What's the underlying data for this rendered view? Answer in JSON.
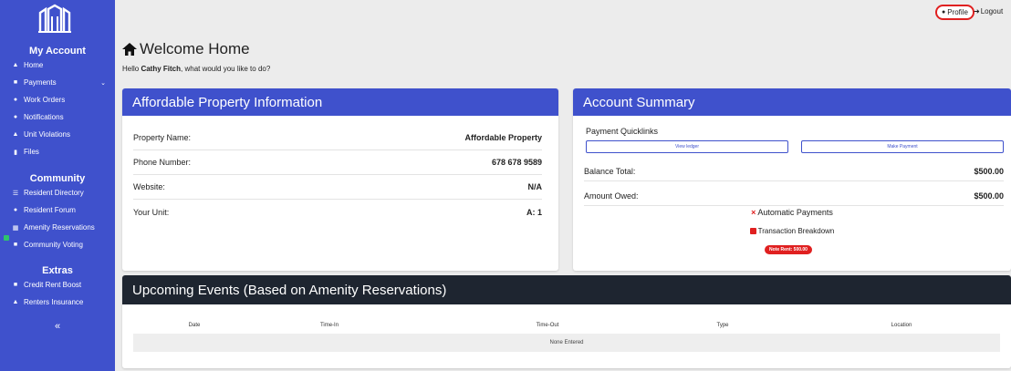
{
  "sidebar": {
    "my_account_title": "My Account",
    "my_account_items": [
      {
        "label": "Home",
        "icon": "home-icon"
      },
      {
        "label": "Payments",
        "icon": "bank-icon"
      },
      {
        "label": "Work Orders",
        "icon": "wrench-icon"
      },
      {
        "label": "Notifications",
        "icon": "chat-icon"
      },
      {
        "label": "Unit Violations",
        "icon": "warning-icon"
      },
      {
        "label": "Files",
        "icon": "file-icon"
      }
    ],
    "community_title": "Community",
    "community_items": [
      {
        "label": "Resident Directory",
        "icon": "directory-icon"
      },
      {
        "label": "Resident Forum",
        "icon": "forum-icon"
      },
      {
        "label": "Amenity Reservations",
        "icon": "calendar-icon"
      },
      {
        "label": "Community Voting",
        "icon": "vote-icon"
      }
    ],
    "extras_title": "Extras",
    "extras_items": [
      {
        "label": "Credit Rent Boost",
        "icon": "bank-icon"
      },
      {
        "label": "Renters Insurance",
        "icon": "home-shield-icon"
      }
    ],
    "collapse_label": "«"
  },
  "topbar": {
    "profile_label": "Profile",
    "logout_label": "Logout"
  },
  "welcome": {
    "title": "Welcome Home",
    "greeting_prefix": "Hello ",
    "user_name": "Cathy Fitch",
    "greeting_suffix": ", what would you like to do?"
  },
  "property_card": {
    "title": "Affordable Property Information",
    "rows": [
      {
        "label": "Property Name:",
        "value": "Affordable Property"
      },
      {
        "label": "Phone Number:",
        "value": "678 678 9589"
      },
      {
        "label": "Website:",
        "value": "N/A"
      },
      {
        "label": "Your Unit:",
        "value": "A: 1"
      }
    ]
  },
  "account_card": {
    "title": "Account Summary",
    "quicklinks_label": "Payment Quicklinks",
    "view_ledger_label": "View ledger",
    "make_payment_label": "Make Payment",
    "rows": [
      {
        "label": "Balance Total:",
        "value": "$500.00"
      },
      {
        "label": "Amount Owed:",
        "value": "$500.00"
      }
    ],
    "auto_pay_mark": "×",
    "auto_pay_label": "Automatic Payments",
    "transaction_label": "Transaction Breakdown",
    "note_pill": "Note Rent: 500.00"
  },
  "events_card": {
    "title": "Upcoming Events (Based on Amenity Reservations)",
    "columns": [
      "Date",
      "Time-In",
      "Time-Out",
      "Type",
      "Location"
    ],
    "empty_text": "None Entered"
  },
  "colors": {
    "accent": "#3f51cc",
    "dark_header": "#1e2530",
    "alert": "#e02020",
    "background": "#ececec"
  }
}
